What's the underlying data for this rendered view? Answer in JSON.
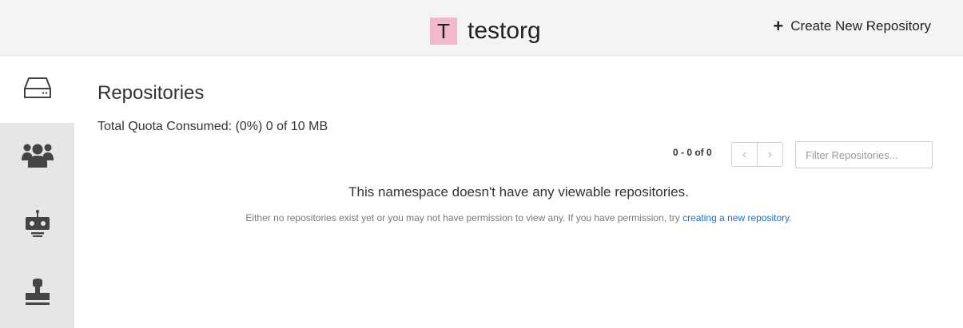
{
  "header": {
    "org_avatar_letter": "T",
    "org_name": "testorg",
    "create_button_label": "Create New Repository",
    "avatar_color": "#f2b8cc"
  },
  "sidebar": {
    "items": [
      {
        "name": "repositories",
        "icon": "hard-drive-icon",
        "active": true
      },
      {
        "name": "teams",
        "icon": "users-group-icon",
        "active": false
      },
      {
        "name": "robot-accounts",
        "icon": "robot-icon",
        "active": false
      },
      {
        "name": "default-permissions",
        "icon": "stamp-icon",
        "active": false
      }
    ]
  },
  "main": {
    "title": "Repositories",
    "quota": "Total Quota Consumed: (0%) 0 of 10 MB",
    "pager_text": "0 - 0 of 0",
    "filter_placeholder": "Filter Repositories...",
    "empty_title": "This namespace doesn't have any viewable repositories.",
    "empty_desc_prefix": "Either no repositories exist yet or you may not have permission to view any. If you have permission, try ",
    "empty_desc_link": "creating a new repository",
    "empty_desc_suffix": "."
  },
  "colors": {
    "link": "#1a6fc9",
    "header_bg": "#f4f4f4",
    "sidebar_bg": "#e6e6e6"
  }
}
